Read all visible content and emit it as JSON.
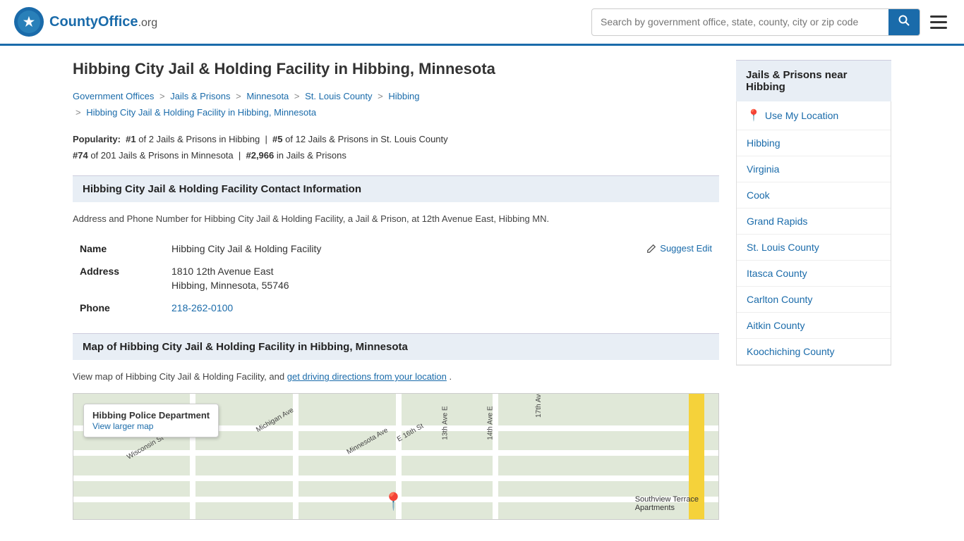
{
  "header": {
    "logo_text": "CountyOffice",
    "logo_suffix": ".org",
    "search_placeholder": "Search by government office, state, county, city or zip code",
    "search_button_label": "🔍"
  },
  "page": {
    "title": "Hibbing City Jail & Holding Facility in Hibbing, Minnesota"
  },
  "breadcrumb": {
    "items": [
      {
        "label": "Government Offices",
        "href": "#"
      },
      {
        "label": "Jails & Prisons",
        "href": "#"
      },
      {
        "label": "Minnesota",
        "href": "#"
      },
      {
        "label": "St. Louis County",
        "href": "#"
      },
      {
        "label": "Hibbing",
        "href": "#"
      },
      {
        "label": "Hibbing City Jail & Holding Facility in Hibbing, Minnesota",
        "href": "#"
      }
    ]
  },
  "popularity": {
    "prefix": "Popularity:",
    "rank1": "#1",
    "rank1_text": "of 2 Jails & Prisons in Hibbing",
    "rank2": "#5",
    "rank2_text": "of 12 Jails & Prisons in St. Louis County",
    "rank3": "#74",
    "rank3_text": "of 201 Jails & Prisons in Minnesota",
    "rank4": "#2,966",
    "rank4_text": "in Jails & Prisons"
  },
  "contact": {
    "section_title": "Hibbing City Jail & Holding Facility Contact Information",
    "description": "Address and Phone Number for Hibbing City Jail & Holding Facility, a Jail & Prison, at 12th Avenue East, Hibbing MN.",
    "name_label": "Name",
    "name_value": "Hibbing City Jail & Holding Facility",
    "address_label": "Address",
    "address_line1": "1810 12th Avenue East",
    "address_line2": "Hibbing, Minnesota, 55746",
    "phone_label": "Phone",
    "phone_value": "218-262-0100",
    "suggest_edit_label": "Suggest Edit"
  },
  "map_section": {
    "section_title": "Map of Hibbing City Jail & Holding Facility in Hibbing, Minnesota",
    "map_text_before": "View map of Hibbing City Jail & Holding Facility, and",
    "map_link_text": "get driving directions from your location",
    "map_text_after": ".",
    "popup_title": "Hibbing Police Department",
    "popup_link": "View larger map"
  },
  "sidebar": {
    "header": "Jails & Prisons near Hibbing",
    "use_location": "Use My Location",
    "items": [
      {
        "label": "Hibbing",
        "href": "#"
      },
      {
        "label": "Virginia",
        "href": "#"
      },
      {
        "label": "Cook",
        "href": "#"
      },
      {
        "label": "Grand Rapids",
        "href": "#"
      },
      {
        "label": "St. Louis County",
        "href": "#"
      },
      {
        "label": "Itasca County",
        "href": "#"
      },
      {
        "label": "Carlton County",
        "href": "#"
      },
      {
        "label": "Aitkin County",
        "href": "#"
      },
      {
        "label": "Koochiching County",
        "href": "#"
      }
    ]
  }
}
